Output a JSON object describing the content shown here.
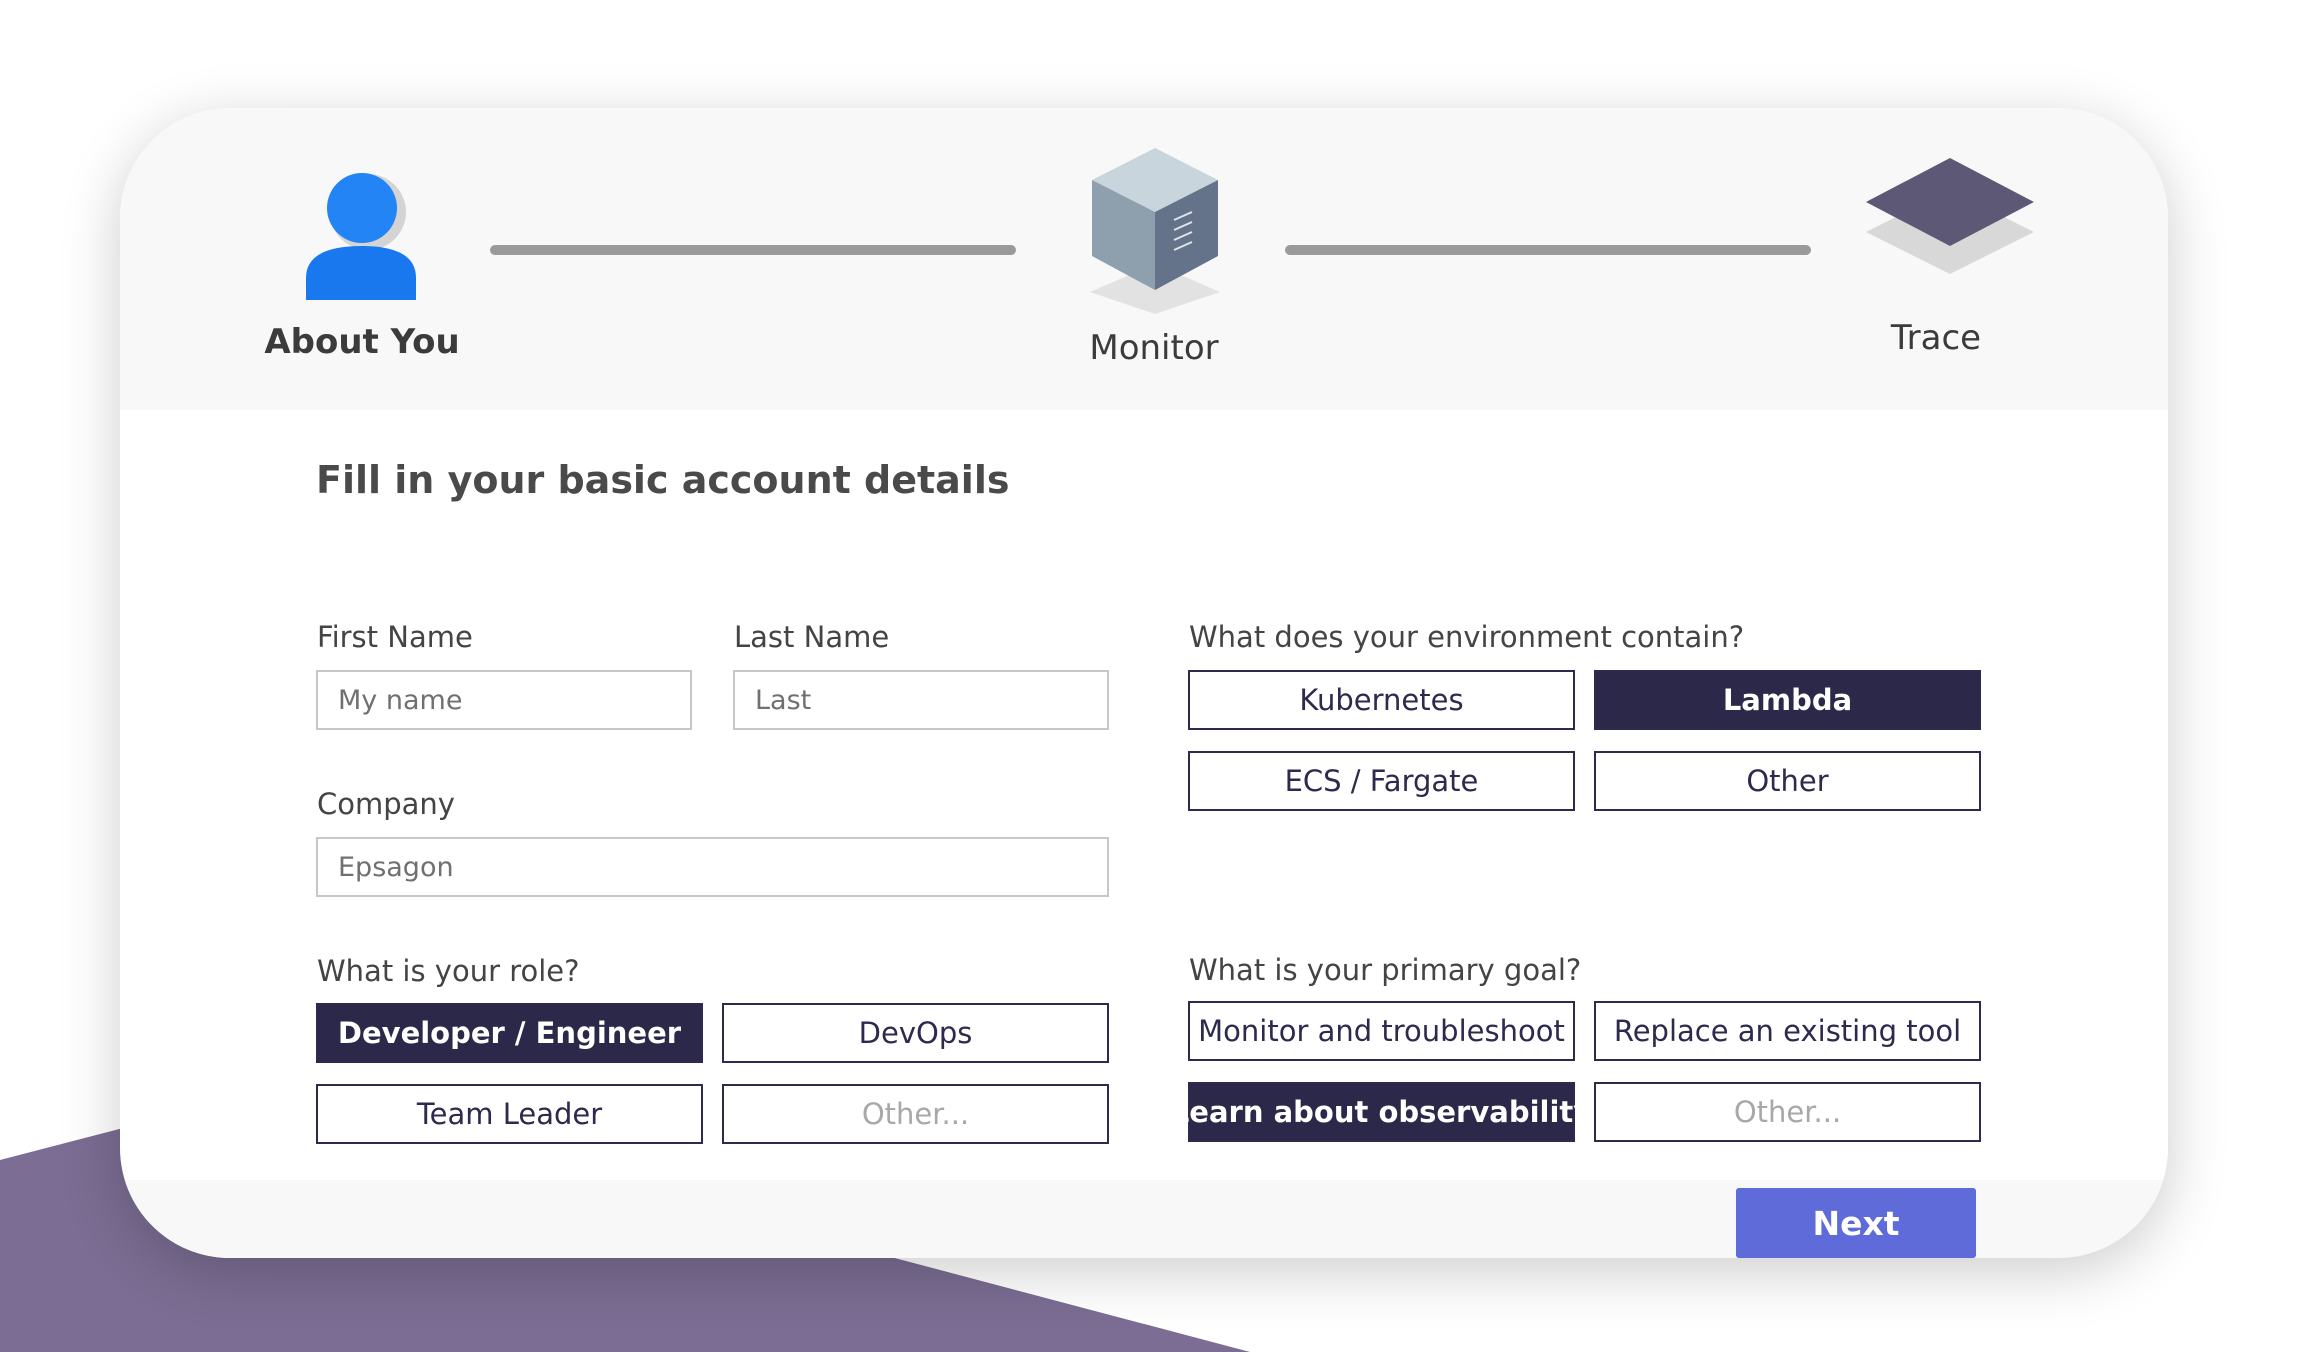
{
  "stepper": {
    "steps": [
      {
        "label": "About You",
        "icon": "user-icon",
        "active": true
      },
      {
        "label": "Monitor",
        "icon": "cube-icon",
        "active": false
      },
      {
        "label": "Trace",
        "icon": "layers-icon",
        "active": false
      }
    ]
  },
  "form": {
    "title": "Fill in your basic account details",
    "first_name": {
      "label": "First Name",
      "placeholder": "My name",
      "value": ""
    },
    "last_name": {
      "label": "Last Name",
      "placeholder": "Last",
      "value": ""
    },
    "company": {
      "label": "Company",
      "placeholder": "Epsagon",
      "value": ""
    },
    "role": {
      "label": "What is your role?",
      "options": [
        {
          "label": "Developer / Engineer",
          "selected": true
        },
        {
          "label": "DevOps",
          "selected": false
        },
        {
          "label": "Team Leader",
          "selected": false
        },
        {
          "label": "Other...",
          "selected": false
        }
      ]
    },
    "environment": {
      "label": "What does your environment contain?",
      "options": [
        {
          "label": "Kubernetes",
          "selected": false
        },
        {
          "label": "Lambda",
          "selected": true
        },
        {
          "label": "ECS / Fargate",
          "selected": false
        },
        {
          "label": "Other",
          "selected": false
        }
      ]
    },
    "goal": {
      "label": "What is your primary goal?",
      "options": [
        {
          "label": "Monitor and troubleshoot",
          "selected": false
        },
        {
          "label": "Replace an existing tool",
          "selected": false
        },
        {
          "label": "Learn about observability",
          "selected": true
        },
        {
          "label": "Other...",
          "selected": false
        }
      ]
    }
  },
  "actions": {
    "next_label": "Next"
  },
  "colors": {
    "accent": "#5e6bd8",
    "selected": "#2b2849",
    "option_border": "#2d2a4d",
    "user_icon": "#1f7ef5",
    "background_shape": "#7b6d93"
  }
}
